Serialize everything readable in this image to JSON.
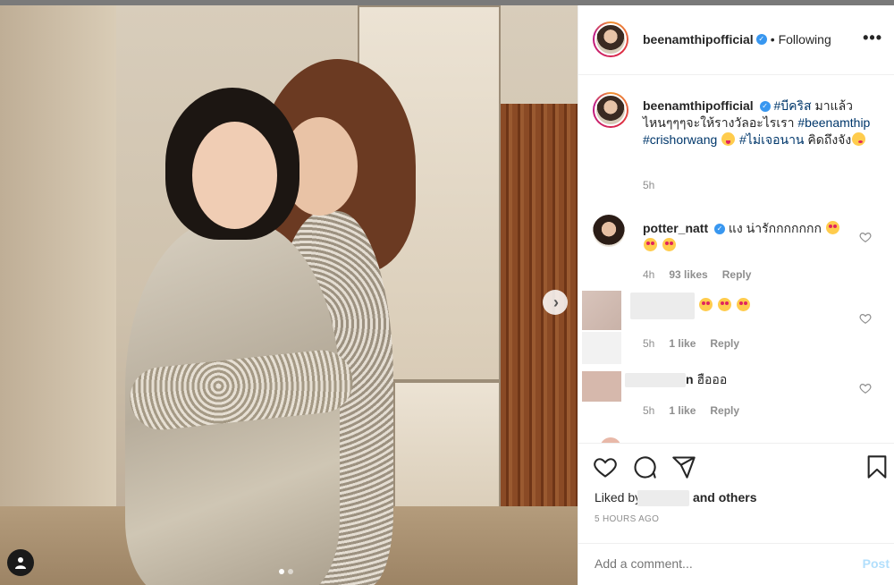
{
  "post": {
    "username": "beenamthipofficial",
    "follow_status": "Following",
    "separator": "•",
    "more_label": "•••"
  },
  "caption": {
    "username": "beenamthipofficial",
    "hashtag1": "#บีคริส",
    "text1": " มาแล้ว ไหนๆๆๆจะให้รางวัลอะไรเรา ",
    "hashtag2": "#beenamthip",
    "hashtag3": "#crishorwang",
    "hashtag4": "#ไม่เจอนาน",
    "text2": " คิดถึงจัง",
    "time": "5h"
  },
  "comments": [
    {
      "username": "potter_natt",
      "text": " แง น่ารักกกกกกก",
      "time": "4h",
      "likes": "93 likes",
      "reply": "Reply"
    },
    {
      "username": "",
      "text": "",
      "time": "5h",
      "likes": "1 like",
      "reply": "Reply"
    },
    {
      "username": "",
      "text": "ฮือออ",
      "username_tail": "n",
      "time": "5h",
      "likes": "1 like",
      "reply": "Reply"
    }
  ],
  "actions": {
    "liked_by_prefix": "Liked by",
    "liked_by_suffix": "and others",
    "timestamp": "5 HOURS AGO"
  },
  "add_comment": {
    "placeholder": "Add a comment...",
    "post_label": "Post"
  },
  "carousel": {
    "next_label": "›",
    "total_dots": 2,
    "active_dot": 1
  },
  "colors": {
    "link": "#00376b",
    "verified": "#3897f0",
    "muted": "#8e8e8e",
    "post_disabled": "#b2dffc"
  },
  "icons": [
    "tag-user-icon",
    "chevron-right-icon",
    "heart-icon",
    "comment-icon",
    "share-icon",
    "bookmark-icon",
    "verified-icon",
    "more-icon"
  ]
}
